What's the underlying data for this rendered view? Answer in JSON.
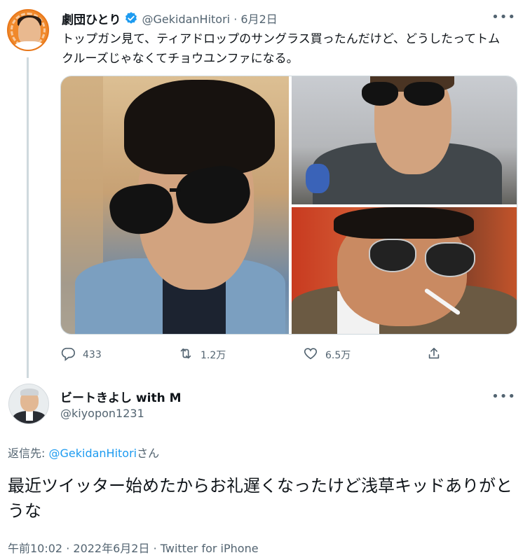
{
  "original_tweet": {
    "display_name": "劇団ひとり",
    "handle": "@GekidanHitori",
    "separator": " · ",
    "date": "6月2日",
    "text": "トップガン見て、ティアドロップのサングラス買ったんだけど、どうしたってトムクルーズじゃなくてチョウユンファになる。",
    "more_icon": "more-horizontal-icon",
    "verified_icon": "verified-badge-icon",
    "actions": {
      "reply_count": "433",
      "retweet_count": "1.2万",
      "like_count": "6.5万"
    }
  },
  "reply_tweet": {
    "display_name": "ビートきよし with M",
    "handle": "@kiyopon1231",
    "reply_to_prefix": "返信先: ",
    "reply_to_mention": "@GekidanHitori",
    "reply_to_suffix": "さん",
    "text": "最近ツイッター始めたからお礼遅くなったけど浅草キッドありがとうな",
    "time": "午前10:02",
    "dot": " · ",
    "date": "2022年6月2日",
    "source": "Twitter for iPhone"
  },
  "colors": {
    "text_primary": "#0f1419",
    "text_secondary": "#536471",
    "link": "#1d9bf0",
    "thread_line": "#cfd9de"
  }
}
